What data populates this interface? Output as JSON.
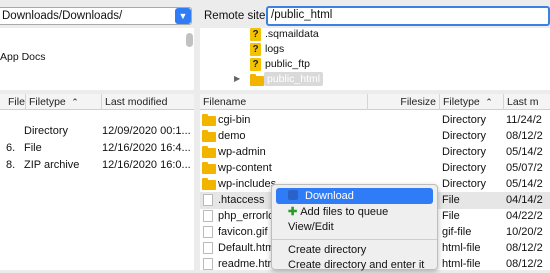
{
  "local": {
    "path_value": "Downloads/Downloads/",
    "tree": [
      "App Docs"
    ],
    "columns": [
      "File",
      "Filetype",
      "Last modified"
    ],
    "rows": [
      {
        "size": "",
        "type": "Directory",
        "modified": "12/09/2020 00:1..."
      },
      {
        "size": "6.",
        "type": "File",
        "modified": "12/16/2020 16:4..."
      },
      {
        "size": "8.",
        "type": "ZIP archive",
        "modified": "12/16/2020 16:0..."
      }
    ]
  },
  "remote": {
    "label": "Remote site:",
    "path_value": "/public_html",
    "tree": [
      {
        "name": ".sqmaildata",
        "icon": "question-icon"
      },
      {
        "name": "logs",
        "icon": "question-icon"
      },
      {
        "name": "public_ftp",
        "icon": "question-icon"
      },
      {
        "name": "public_html",
        "icon": "folder-icon"
      }
    ],
    "columns": [
      "Filename",
      "Filesize",
      "Filetype",
      "Last m"
    ],
    "rows": [
      {
        "name": "cgi-bin",
        "type": "Directory",
        "modified": "11/24/2",
        "icon": "folder"
      },
      {
        "name": "demo",
        "type": "Directory",
        "modified": "08/12/2",
        "icon": "folder"
      },
      {
        "name": "wp-admin",
        "type": "Directory",
        "modified": "05/14/2",
        "icon": "folder"
      },
      {
        "name": "wp-content",
        "type": "Directory",
        "modified": "05/07/2",
        "icon": "folder"
      },
      {
        "name": "wp-includes",
        "type": "Directory",
        "modified": "05/14/2",
        "icon": "folder"
      },
      {
        "name": ".htaccess",
        "type": "File",
        "modified": "04/14/2",
        "icon": "file"
      },
      {
        "name": "php_errorlo",
        "type": "File",
        "modified": "04/22/2",
        "icon": "file"
      },
      {
        "name": "favicon.gif",
        "type": "gif-file",
        "modified": "10/20/2",
        "icon": "file"
      },
      {
        "name": "Default.htm",
        "type": "html-file",
        "modified": "08/12/2",
        "icon": "file"
      },
      {
        "name": "readme.htm",
        "type": "html-file",
        "modified": "08/12/2",
        "icon": "file"
      }
    ]
  },
  "context_menu": {
    "download": "Download",
    "add_to_queue": "Add files to queue",
    "view_edit": "View/Edit",
    "create_directory": "Create directory",
    "create_directory_enter": "Create directory and enter it"
  },
  "colors": {
    "accent": "#2f7cf6",
    "folder": "#f3b400"
  }
}
